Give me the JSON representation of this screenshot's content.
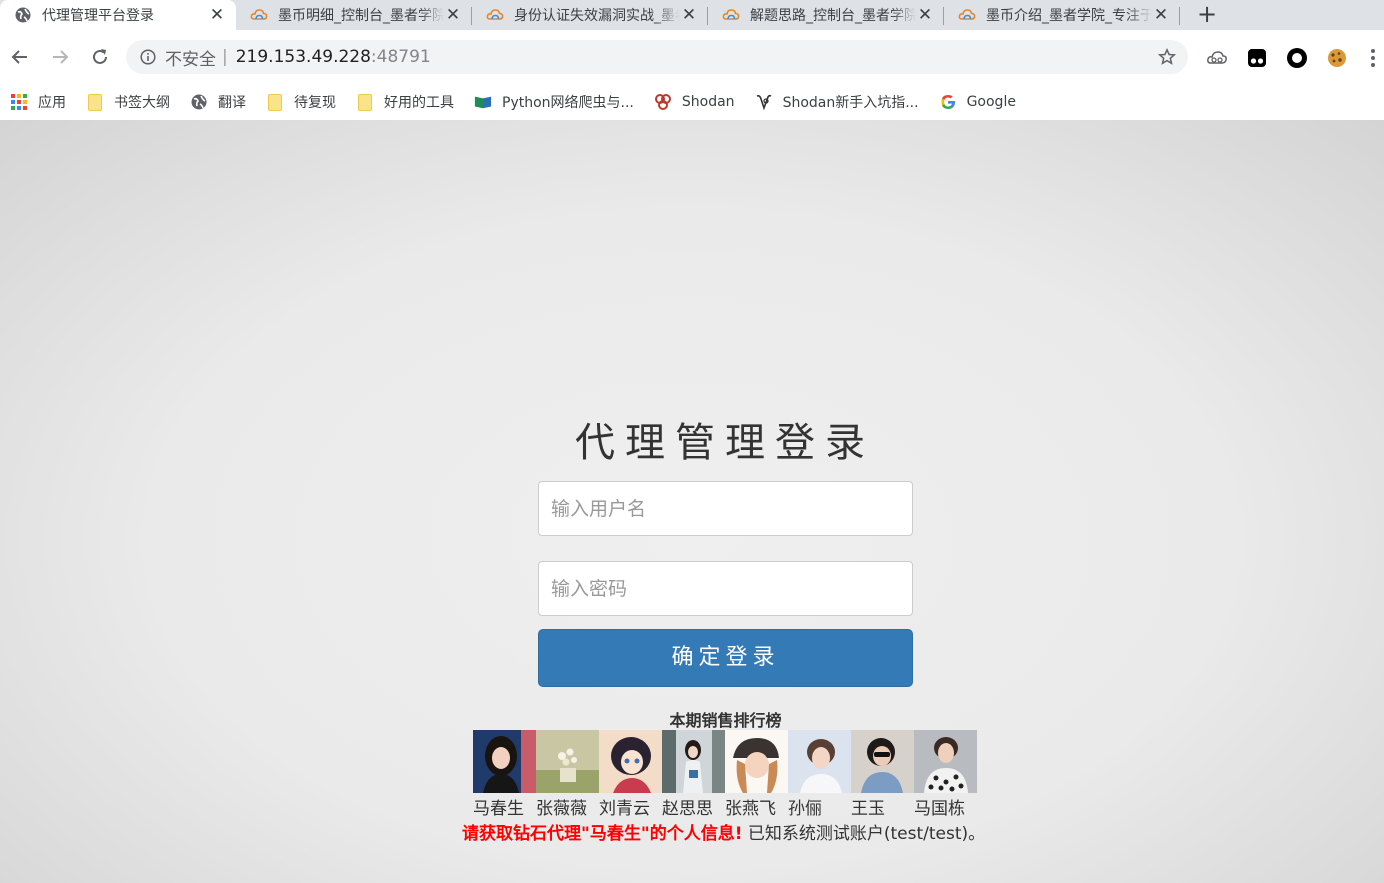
{
  "browser": {
    "tabs": [
      {
        "title": "代理管理平台登录",
        "active": true,
        "icon": "globe-icon"
      },
      {
        "title": "墨币明细_控制台_墨者学院",
        "active": false,
        "icon": "mozhe-cloud-icon"
      },
      {
        "title": "身份认证失效漏洞实战_墨者学院",
        "active": false,
        "icon": "mozhe-cloud-icon"
      },
      {
        "title": "解题思路_控制台_墨者学院",
        "active": false,
        "icon": "mozhe-cloud-icon"
      },
      {
        "title": "墨币介绍_墨者学院_专注于网络安全",
        "active": false,
        "icon": "mozhe-cloud-icon"
      }
    ],
    "close_glyph": "✕",
    "new_tab_glyph": "+",
    "address": {
      "security_label": "不安全",
      "separator": "|",
      "host": "219.153.49.228",
      "port": ":48791"
    },
    "bookmarks": [
      {
        "label": "应用",
        "icon": "apps-grid-icon"
      },
      {
        "label": "书签大纲",
        "icon": "folder-icon"
      },
      {
        "label": "翻译",
        "icon": "globe-icon"
      },
      {
        "label": "待复现",
        "icon": "folder-icon"
      },
      {
        "label": "好用的工具",
        "icon": "folder-icon"
      },
      {
        "label": "Python网络爬虫与...",
        "icon": "book-flag-icon"
      },
      {
        "label": "Shodan",
        "icon": "shodan-icon"
      },
      {
        "label": "Shodan新手入坑指...",
        "icon": "shodan-script-icon"
      },
      {
        "label": "Google",
        "icon": "google-icon"
      }
    ],
    "colors": {
      "accent": "#1a73e8",
      "tab_strip": "#dee1e6"
    }
  },
  "login": {
    "title": "代理管理登录",
    "username_placeholder": "输入用户名",
    "password_placeholder": "输入密码",
    "submit_label": "确定登录",
    "button_color": "#337ab7"
  },
  "ranking": {
    "title": "本期销售排行榜",
    "agents": [
      {
        "name": "马春生"
      },
      {
        "name": "张薇薇"
      },
      {
        "name": "刘青云"
      },
      {
        "name": "赵思思"
      },
      {
        "name": "张燕飞"
      },
      {
        "name": "孙俪"
      },
      {
        "name": "王玉"
      },
      {
        "name": "马国栋"
      }
    ]
  },
  "footer": {
    "warning": "请获取钻石代理\"马春生\"的个人信息!",
    "note": "已知系统测试账户(test/test)。",
    "warning_color": "#ff0000"
  }
}
